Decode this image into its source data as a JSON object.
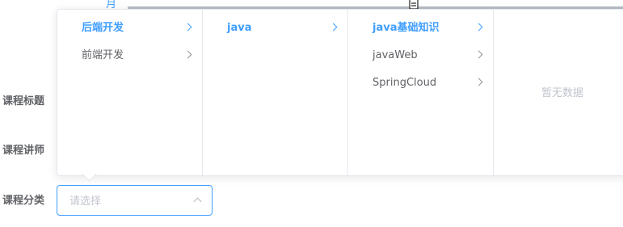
{
  "form": {
    "labels": {
      "title": "课程标题",
      "teacher": "课程讲师",
      "category": "课程分类"
    },
    "category_select": {
      "placeholder": "请选择",
      "value": ""
    }
  },
  "cascader": {
    "columns": [
      {
        "items": [
          {
            "label": "后端开发",
            "active": true
          },
          {
            "label": "前端开发",
            "active": false
          }
        ]
      },
      {
        "items": [
          {
            "label": "java",
            "active": true
          }
        ]
      },
      {
        "items": [
          {
            "label": "java基础知识",
            "active": true
          },
          {
            "label": "javaWeb",
            "active": false
          },
          {
            "label": "SpringCloud",
            "active": false
          }
        ]
      }
    ],
    "empty_text": "暂无数据"
  },
  "colors": {
    "accent": "#409eff",
    "text": "#606266",
    "placeholder": "#c0c4cc",
    "border": "#e4e7ed"
  }
}
